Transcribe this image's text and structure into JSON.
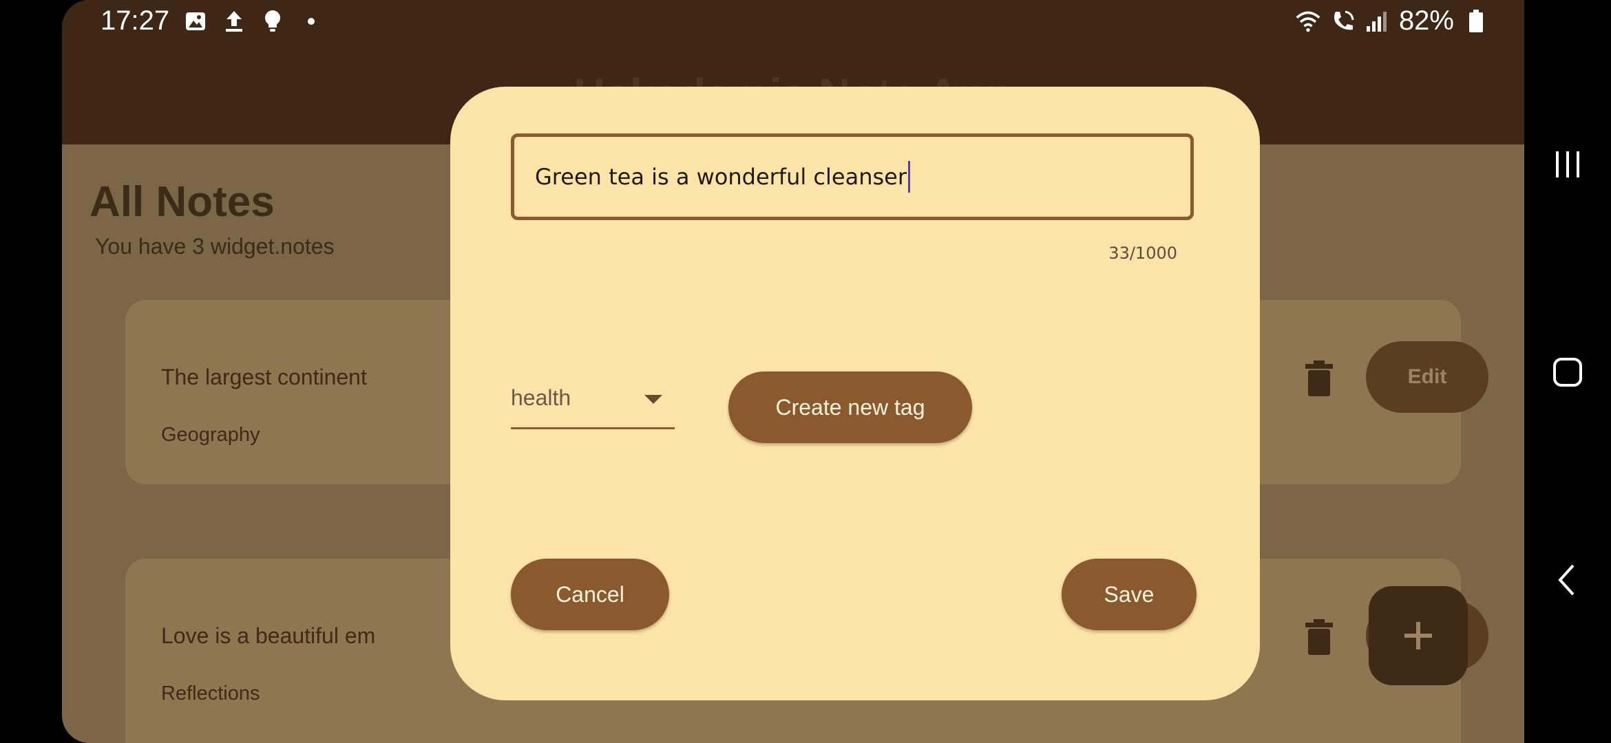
{
  "status_bar": {
    "time": "17:27",
    "battery": "82%"
  },
  "app": {
    "title": "Hakademia Note App"
  },
  "notes_screen": {
    "heading": "All Notes",
    "subheading": "You have 3 widget.notes",
    "notes": [
      {
        "text": "The largest continent",
        "tag": "Geography",
        "edit_label": "Edit"
      },
      {
        "text": "Love is a beautiful em",
        "tag": "Reflections",
        "edit_label": "Ed"
      }
    ],
    "fab_label": "+"
  },
  "dialog": {
    "note_text": "Green tea is a wonderful cleanser",
    "char_counter": "33/1000",
    "selected_tag": "health",
    "create_tag_label": "Create new tag",
    "cancel_label": "Cancel",
    "save_label": "Save"
  },
  "colors": {
    "app_bar": "#3e2815",
    "dialog_bg": "#fce4a9",
    "button_bg": "#8a5a2e",
    "scrim_bg": "#7b6647"
  },
  "icons": [
    "gallery-icon",
    "upload-icon",
    "bulb-icon",
    "wifi-icon",
    "wifi-call-icon",
    "signal-icon",
    "battery-icon",
    "trash-icon",
    "recents-icon",
    "home-icon",
    "back-icon"
  ]
}
